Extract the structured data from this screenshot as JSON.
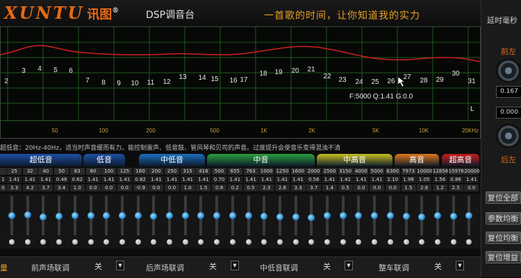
{
  "header": {
    "logo": "XUNTU",
    "logo_cn": "讯图",
    "trademark": "®",
    "app_title": "DSP调音台",
    "slogan": "一首歌的时间，让你知道我的实力"
  },
  "eq_graph": {
    "bands": [
      "2",
      "3",
      "4",
      "5",
      "6",
      "7",
      "8",
      "9",
      "10",
      "11",
      "12",
      "13",
      "14",
      "15",
      "16",
      "17",
      "18",
      "19",
      "20",
      "21",
      "22",
      "23",
      "24",
      "25",
      "26",
      "27",
      "28",
      "29",
      "30",
      "31"
    ],
    "freq_ticks": [
      "50",
      "100",
      "200",
      "500",
      "1K",
      "2K",
      "5K",
      "10K",
      "20KHz"
    ],
    "selected_band": "26",
    "filter_info": "F:5000  Q:1.41  G:0.0",
    "side_marker": "L"
  },
  "right_panel": {
    "delay_title": "延时毫秒",
    "front_left": "前左",
    "front_left_value": "0.167",
    "rear_value": "0.000",
    "rear_left": "后左",
    "buttons": [
      "复位全部",
      "参数均衡",
      "复位均衡",
      "复位增益"
    ]
  },
  "description": "超低音：20Hz-40Hz，适当时声音缓而有力。能控制雷声、低音鼓、管风琴和贝司的声音。过度提升会使音乐变得混浊不清",
  "categories": [
    {
      "label": "超低音",
      "color": "#1e4fa8"
    },
    {
      "label": "低音",
      "color": "#1e4fa8"
    },
    {
      "label": "中低音",
      "color": "#1a6fc0"
    },
    {
      "label": "中音",
      "color": "#2aa040"
    },
    {
      "label": "中高音",
      "color": "#c8c020"
    },
    {
      "label": "高音",
      "color": "#e07818"
    },
    {
      "label": "超高音",
      "color": "#c81e1e"
    }
  ],
  "table": {
    "freq": [
      "25",
      "32",
      "40",
      "50",
      "63",
      "80",
      "100",
      "125",
      "160",
      "200",
      "250",
      "315",
      "418",
      "500",
      "655",
      "763",
      "1000",
      "1250",
      "1600",
      "2000",
      "2500",
      "3150",
      "4000",
      "5000",
      "6300",
      "7973",
      "10000",
      "12858",
      "15978",
      "20000"
    ],
    "q": [
      "1.41",
      "1.41",
      "1.41",
      "0.48",
      "0.62",
      "1.41",
      "1.41",
      "1.41",
      "0.82",
      "1.41",
      "1.41",
      "1.41",
      "1.41",
      "0.70",
      "1.41",
      "1.41",
      "1.41",
      "1.41",
      "1.41",
      "0.56",
      "1.41",
      "1.41",
      "1.41",
      "1.41",
      "2.10",
      "1.98",
      "1.05",
      "1.56",
      "0.86",
      "1.41"
    ],
    "gain": [
      "3.3",
      "4.2",
      "3.7",
      "3.4",
      "1.0",
      "0.0",
      "0.0",
      "0.0",
      "-0.9",
      "0.0",
      "0.0",
      "1.0",
      "1.5",
      "0.8",
      "0.2",
      "0.5",
      "2.3",
      "2.8",
      "3.3",
      "3.7",
      "1.4",
      "0.5",
      "0.0",
      "0.0",
      "0.0",
      "1.5",
      "2.8",
      "1.2",
      "2.5",
      "0.0"
    ],
    "leading": {
      "freq": "",
      "q": "1",
      "gain": "0"
    }
  },
  "sliders": {
    "knob_levels": [
      0.5,
      0.52,
      0.45,
      0.47,
      0.5,
      0.5,
      0.5,
      0.5,
      0.5,
      0.48,
      0.5,
      0.5,
      0.5,
      0.5,
      0.5,
      0.5,
      0.48,
      0.46,
      0.45,
      0.44,
      0.5,
      0.5,
      0.5,
      0.5,
      0.5,
      0.48,
      0.46,
      0.5,
      0.48,
      0.5
    ]
  },
  "bottom_bar": {
    "left_cut": "量",
    "items": [
      {
        "label": "前声场联调",
        "value": "关"
      },
      {
        "label": "后声场联调",
        "value": "关"
      },
      {
        "label": "中低音联调",
        "value": "关"
      },
      {
        "label": "整车联调",
        "value": "关"
      }
    ]
  }
}
